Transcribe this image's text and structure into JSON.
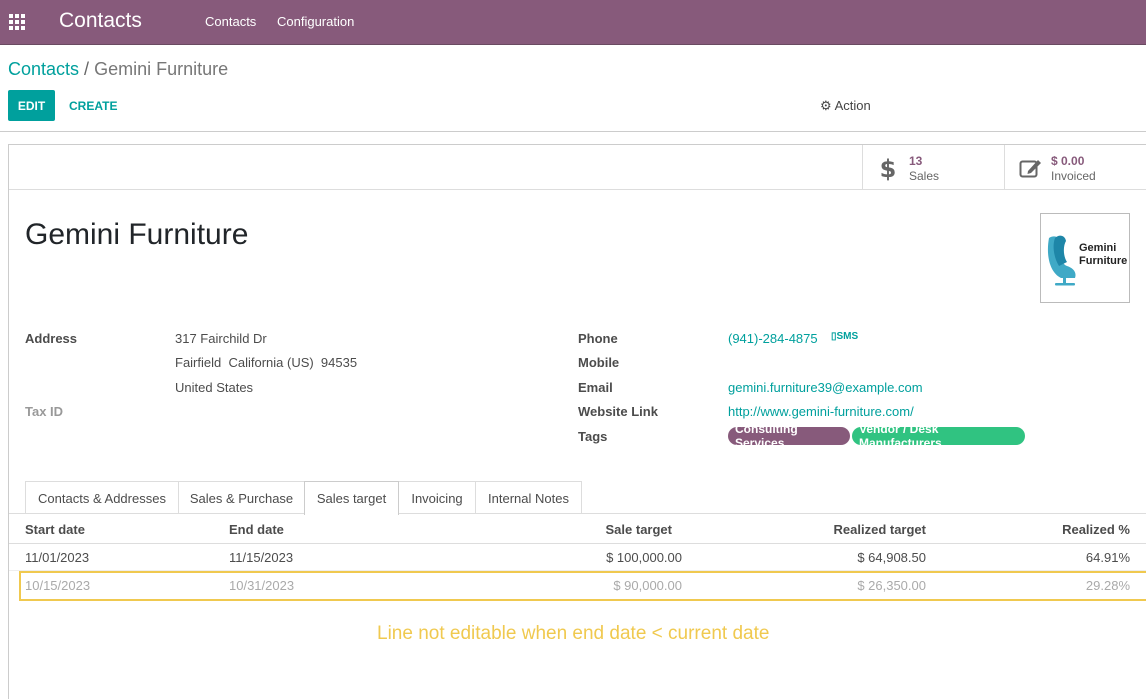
{
  "topbar": {
    "app_title": "Contacts",
    "menu": [
      "Contacts",
      "Configuration"
    ]
  },
  "breadcrumb": {
    "parent": "Contacts",
    "separator": "/",
    "current": "Gemini Furniture"
  },
  "buttons": {
    "edit": "EDIT",
    "create": "CREATE",
    "action": "Action"
  },
  "stats": {
    "sales_count": "13",
    "sales_label": "Sales",
    "invoiced_amount": "$ 0.00",
    "invoiced_label": "Invoiced"
  },
  "partner": {
    "name": "Gemini Furniture",
    "logo_text_1": "Gemini",
    "logo_text_2": "Furniture"
  },
  "fields": {
    "address_label": "Address",
    "address_line1": "317 Fairchild Dr",
    "address_line2": "Fairfield  California (US)  94535",
    "address_line3": "United States",
    "taxid_label": "Tax ID",
    "phone_label": "Phone",
    "phone_value": "(941)-284-4875",
    "sms_label": "SMS",
    "mobile_label": "Mobile",
    "email_label": "Email",
    "email_value": "gemini.furniture39@example.com",
    "website_label": "Website Link",
    "website_value": "http://www.gemini-furniture.com/",
    "tags_label": "Tags",
    "tags": [
      {
        "label": "Consulting Services",
        "color": "#875a7b"
      },
      {
        "label": "Vendor / Desk Manufacturers",
        "color": "#30c381"
      }
    ]
  },
  "tabs": [
    "Contacts & Addresses",
    "Sales & Purchase",
    "Sales target",
    "Invoicing",
    "Internal Notes"
  ],
  "active_tab": "Sales target",
  "table": {
    "headers": [
      "Start date",
      "End date",
      "Sale target",
      "Realized target",
      "Realized %"
    ],
    "rows": [
      [
        "11/01/2023",
        "11/15/2023",
        "$ 100,000.00",
        "$ 64,908.50",
        "64.91%"
      ],
      [
        "10/15/2023",
        "10/31/2023",
        "$ 90,000.00",
        "$ 26,350.00",
        "29.28%"
      ]
    ]
  },
  "annotation": "Line not editable when end date < current date",
  "colors": {
    "brand": "#875a7b",
    "accent": "#00a09d",
    "highlight": "#f0c94f"
  }
}
